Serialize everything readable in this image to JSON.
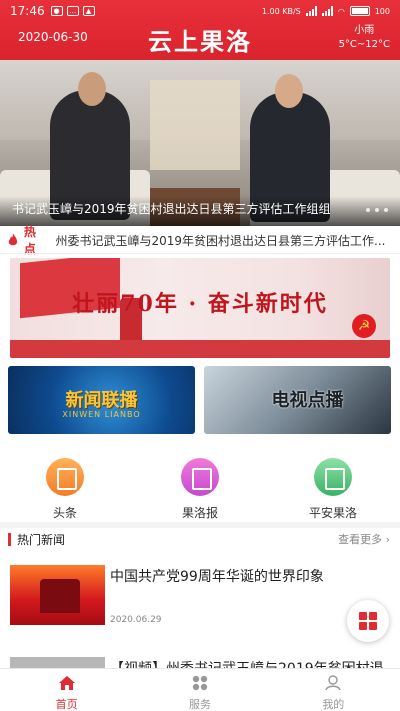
{
  "status_bar": {
    "time": "17:46",
    "speed": "1.00 KB/S",
    "battery": "100",
    "battery_level": 1.0
  },
  "header": {
    "date": "2020-06-30",
    "app_logo": "云上果洛",
    "weather_desc": "小雨",
    "weather_temp": "5°C~12°C"
  },
  "banner": {
    "caption": "书记武玉嶂与2019年贫困村退出达日县第三方评估工作组组"
  },
  "hot": {
    "label": "热点",
    "text": "州委书记武玉嶂与2019年贫困村退出达日县第三方评估工作..."
  },
  "promo": {
    "text": "壮丽70年 · 奋斗新时代"
  },
  "tiles": {
    "news": {
      "title": "新闻联播",
      "subtitle": "XINWEN LIANBO"
    },
    "tv": {
      "title": "电视点播"
    }
  },
  "quick_nav": [
    {
      "label": "头条",
      "icon": "headline-icon"
    },
    {
      "label": "果洛报",
      "icon": "newspaper-icon"
    },
    {
      "label": "平安果洛",
      "icon": "safe-icon"
    }
  ],
  "section": {
    "title": "热门新闻",
    "more": "查看更多 ›"
  },
  "news": [
    {
      "title": "中国共产党99周年华诞的世界印象",
      "date": "2020.06.29"
    },
    {
      "title": "【视频】州委书记武玉嶂与2019年贫困村退"
    }
  ],
  "tabs": [
    {
      "label": "首页",
      "icon": "home-icon",
      "active": true
    },
    {
      "label": "服务",
      "icon": "services-icon",
      "active": false
    },
    {
      "label": "我的",
      "icon": "profile-icon",
      "active": false
    }
  ],
  "colors": {
    "brand_red": "#e02b33",
    "header_red": "#d9232d"
  }
}
